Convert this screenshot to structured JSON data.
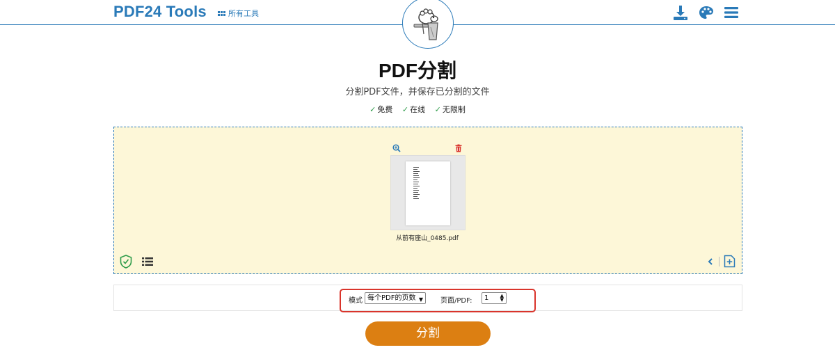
{
  "header": {
    "brand": "PDF24 Tools",
    "all_tools": "所有工具",
    "icons": [
      "download-icon",
      "palette-icon",
      "menu-icon"
    ]
  },
  "main": {
    "title": "PDF分割",
    "subtitle": "分割PDF文件，并保存已分割的文件",
    "features": [
      "免费",
      "在线",
      "无限制"
    ]
  },
  "dropzone": {
    "file_name": "从前有座山_0485.pdf",
    "icons": [
      "zoom-icon",
      "trash-icon",
      "shield-icon",
      "list-icon",
      "chevron-left-icon",
      "add-file-icon"
    ]
  },
  "options": {
    "mode_label": "模式",
    "mode_value": "每个PDF的页数",
    "pages_label": "页面/PDF:",
    "pages_value": "1"
  },
  "action": {
    "split_label": "分割"
  },
  "colors": {
    "brand": "#2a7ab8",
    "dropzone_bg": "#fdf7d8",
    "button": "#dc7f12",
    "highlight": "#d9342b",
    "check": "#2e9c4a"
  }
}
